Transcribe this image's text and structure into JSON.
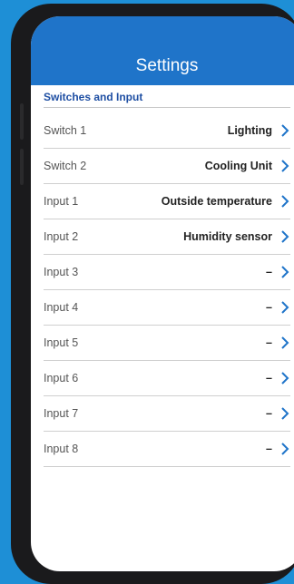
{
  "header": {
    "title": "Settings"
  },
  "section": {
    "title": "Switches and Input"
  },
  "colors": {
    "accent": "#1f74c9",
    "section_text": "#1f4fa3",
    "background": "#1e8fd6"
  },
  "rows": [
    {
      "label": "Switch 1",
      "value": "Lighting"
    },
    {
      "label": "Switch 2",
      "value": "Cooling Unit"
    },
    {
      "label": "Input 1",
      "value": "Outside temperature"
    },
    {
      "label": "Input 2",
      "value": "Humidity sensor"
    },
    {
      "label": "Input 3",
      "value": "–"
    },
    {
      "label": "Input 4",
      "value": "–"
    },
    {
      "label": "Input 5",
      "value": "–"
    },
    {
      "label": "Input 6",
      "value": "–"
    },
    {
      "label": "Input 7",
      "value": "–"
    },
    {
      "label": "Input 8",
      "value": "–"
    }
  ]
}
